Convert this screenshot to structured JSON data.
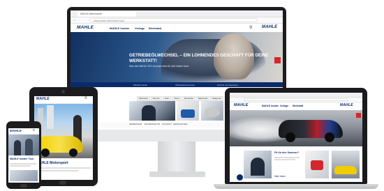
{
  "brand": {
    "logo": "MAHLE",
    "primary": "#0a2b6b",
    "accent": "#d4262c"
  },
  "desktop": {
    "tab_title": "MAHLE Aftermarket",
    "address": "www.mahle-aftermarket.com",
    "nav": [
      "MAHLE Insider",
      "Verlage",
      "Werkstatt"
    ],
    "hero": {
      "title": "Getriebeölwechsel – ein lohnendes Geschäft für deine Werkstatt!",
      "subtitle": "Was das MAHLE ATX-Konzept alles für dich leisten kann"
    },
    "strip_items": [
      "MAHLE Insider",
      "Werkstatt-Know-how",
      "Technik und Neuheiten"
    ],
    "tags": [
      "Werkstatt",
      "Service",
      "Filter",
      "Klima",
      "Motorteile",
      "Elektronik",
      "Diagnose",
      "Motorsport",
      "Technik",
      "Tipps"
    ],
    "footer": [
      "IMPRESSUM",
      "DATENSCHUTZ",
      "KONTAKT",
      "NEWSLETTER"
    ]
  },
  "tablet": {
    "nav": [
      "MAHLE",
      "Insider"
    ],
    "headline": "MAHLE Motorsport"
  },
  "phone": {
    "headline": "MAHLE Insider Tour"
  },
  "laptop": {
    "nav": [
      "MAHLE Insider",
      "Verlage",
      "Werkstatt"
    ],
    "teaser": "Fit für den Sommer?",
    "more": "Mehr lesen"
  },
  "icons": [
    "search-icon",
    "menu-icon",
    "chat-icon",
    "bookmark-icon"
  ]
}
